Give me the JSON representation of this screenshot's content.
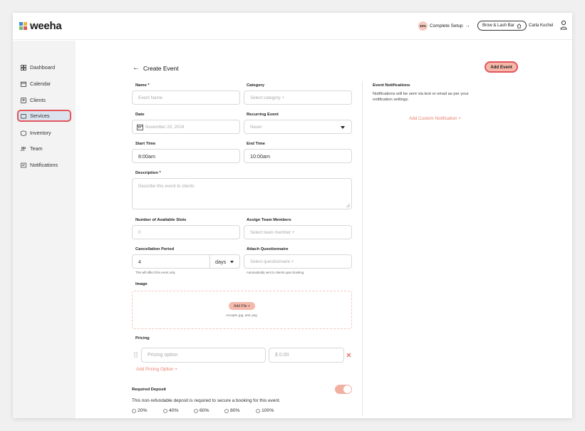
{
  "brand": {
    "name": "weeha",
    "mark_colors": [
      "#3b8ed8",
      "#f3b338",
      "#6fbf73",
      "#e25555"
    ]
  },
  "header": {
    "setup_percent": "25%",
    "setup_label": "Complete Setup",
    "setup_arrow": "→",
    "business_name": "Brow & Lash Bar",
    "user_name": "Carla Kuchel"
  },
  "sidebar": {
    "items": [
      {
        "label": "Dashboard",
        "icon": "dashboard-icon"
      },
      {
        "label": "Calendar",
        "icon": "calendar-icon"
      },
      {
        "label": "Clients",
        "icon": "clients-icon"
      },
      {
        "label": "Services",
        "icon": "services-icon",
        "active": true
      },
      {
        "label": "Inventory",
        "icon": "inventory-icon"
      },
      {
        "label": "Team",
        "icon": "team-icon"
      },
      {
        "label": "Notifications",
        "icon": "notifications-icon"
      }
    ]
  },
  "page": {
    "back_arrow": "←",
    "title": "Create Event",
    "add_event_label": "Add Event"
  },
  "form": {
    "name": {
      "label": "Name *",
      "placeholder": "Event Name"
    },
    "category": {
      "label": "Category",
      "placeholder": "Select category +"
    },
    "date": {
      "label": "Date",
      "value": "November 20, 2024"
    },
    "recurring": {
      "label": "Recurring Event",
      "value": "Never"
    },
    "start_time": {
      "label": "Start Time",
      "value": "8:00am"
    },
    "end_time": {
      "label": "End Time",
      "value": "10:00am"
    },
    "description": {
      "label": "Description *",
      "placeholder": "Describe this event to clients"
    },
    "slots": {
      "label": "Number of Available Slots",
      "placeholder": "0"
    },
    "team": {
      "label": "Assign Team Members",
      "placeholder": "Select team member +"
    },
    "cancellation": {
      "label": "Cancellation Period",
      "value": "4",
      "unit": "days",
      "hint": "This will affect this event only."
    },
    "questionnaire": {
      "label": "Attach Questionnaire",
      "placeholder": "Select questionnaire +",
      "hint": "Automatically sent to clients upon booking."
    },
    "image": {
      "label": "Image",
      "add_file": "Add File +",
      "accepts": "Accepts .jpg, and .png"
    },
    "pricing": {
      "label": "Pricing",
      "option_placeholder": "Pricing option",
      "price_placeholder": "$ 0.00",
      "add_option": "Add Pricing Option +"
    },
    "deposit": {
      "label": "Required Deposit",
      "description": "This non-refundable deposit is required to secure a booking for this event.",
      "enabled": true,
      "options": [
        "20%",
        "40%",
        "60%",
        "80%",
        "100%"
      ]
    }
  },
  "notifications_panel": {
    "title": "Event Notifications",
    "text_line1": "Notifications will be sent via text or email as per your",
    "text_line2": "notification settings.",
    "add_custom": "Add Custom Notification +"
  },
  "colors": {
    "accent": "#e87f6c",
    "accent_bg": "#f6b8ab",
    "highlight_border": "#e2555b",
    "sidebar_bg": "#f3f3f4",
    "active_bg": "#dbe4ee"
  }
}
